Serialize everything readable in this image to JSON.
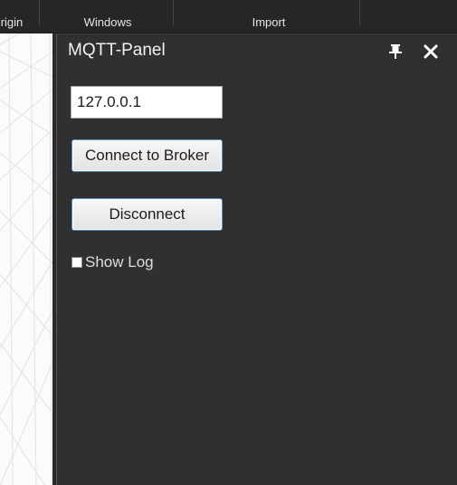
{
  "menubar": {
    "items": [
      {
        "label": "rigin"
      },
      {
        "label": "Windows"
      },
      {
        "label": "Import"
      }
    ]
  },
  "panel": {
    "title": "MQTT-Panel",
    "pin_icon": "pin-icon",
    "close_icon": "close-icon",
    "host_input": {
      "value": "127.0.0.1"
    },
    "connect_label": "Connect to Broker",
    "disconnect_label": "Disconnect",
    "show_log": {
      "label": "Show Log",
      "checked": false
    }
  },
  "colors": {
    "panel_bg": "#303030",
    "menubar_bg": "#262626",
    "viewport_bg": "#fbfbfb",
    "button_border": "#5a8fc7"
  }
}
